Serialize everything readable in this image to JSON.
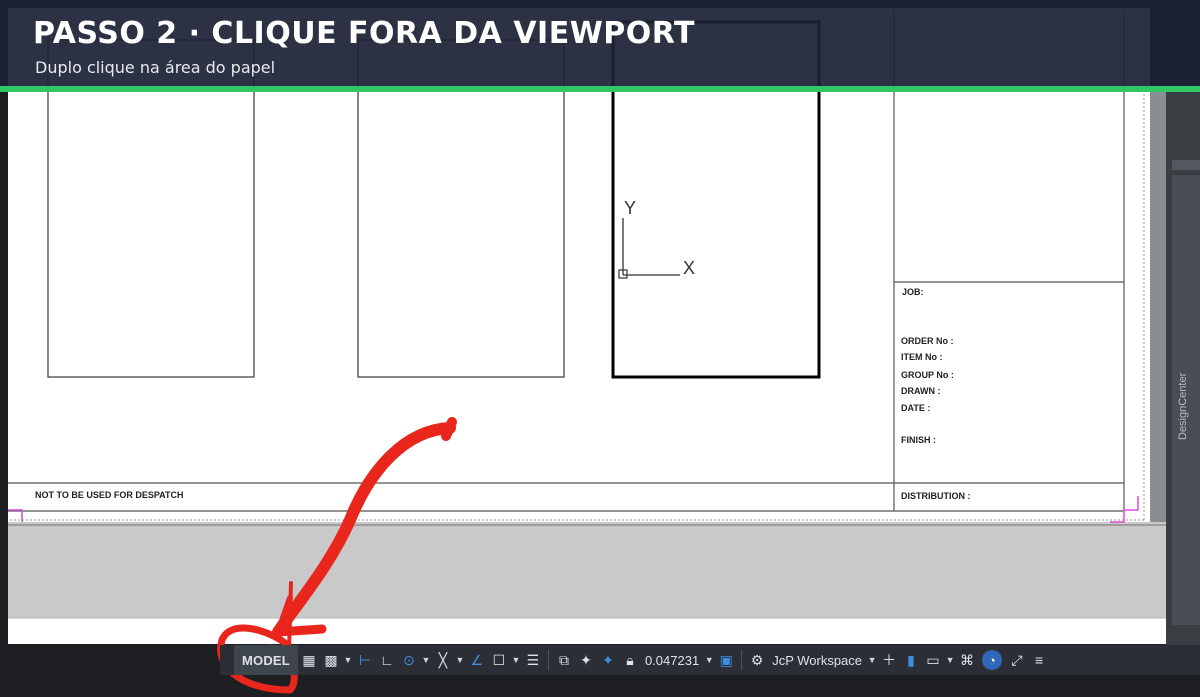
{
  "banner": {
    "title": "PASSO 2 · CLIQUE FORA DA VIEWPORT",
    "subtitle": "Duplo clique na área do papel",
    "accent_color": "#2fc764"
  },
  "drawing": {
    "axis_y": "Y",
    "axis_x": "X",
    "note": "NOT TO BE USED FOR DESPATCH",
    "title_block": {
      "job": "JOB:",
      "order": "ORDER No :",
      "item": "ITEM No :",
      "group": "GROUP No :",
      "drawn": "DRAWN :",
      "date": "DATE :",
      "finish": "FINISH :",
      "distribution": "DISTRIBUTION :"
    }
  },
  "side_panel": {
    "label": "DesignCenter"
  },
  "statusbar": {
    "model": "MODEL",
    "scale": "0.047231",
    "workspace": "JcP Workspace",
    "icons": [
      "grid-icon",
      "snap-icon",
      "dropdown",
      "ortho-icon",
      "polar-icon",
      "osnap-icon",
      "otrack-icon",
      "isodraft-icon",
      "lineweight-icon",
      "transparency-icon",
      "selection-cycling-icon",
      "annotation-scale-icon",
      "annotation-visibility-icon",
      "lock-icon",
      "gear-icon",
      "plus-icon",
      "units-icon",
      "hardware-accel-icon",
      "isolate-icon",
      "clean-screen-icon",
      "menu-icon"
    ]
  },
  "annotation": {
    "stroke_color": "#e8261c"
  }
}
